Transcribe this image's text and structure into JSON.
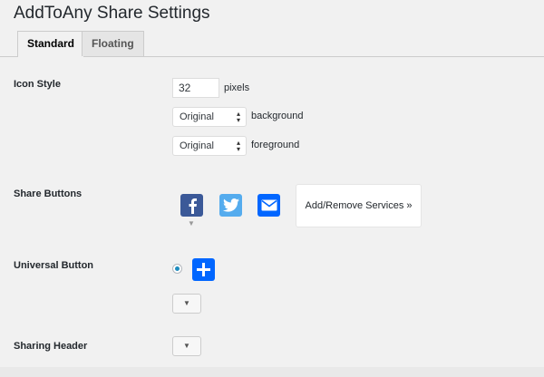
{
  "page": {
    "title": "AddToAny Share Settings"
  },
  "tabs": [
    {
      "label": "Standard",
      "active": true
    },
    {
      "label": "Floating",
      "active": false
    }
  ],
  "icon_style": {
    "label": "Icon Style",
    "size_value": "32",
    "size_unit": "pixels",
    "background_select": "Original",
    "background_label": "background",
    "foreground_select": "Original",
    "foreground_label": "foreground"
  },
  "share_buttons": {
    "label": "Share Buttons",
    "services": [
      {
        "name": "Facebook",
        "icon": "facebook-icon",
        "color": "#3b5998"
      },
      {
        "name": "Twitter",
        "icon": "twitter-icon",
        "color": "#55acee"
      },
      {
        "name": "Email",
        "icon": "email-icon",
        "color": "#0166ff"
      }
    ],
    "add_remove_label": "Add/Remove Services »"
  },
  "universal_button": {
    "label": "Universal Button",
    "icon": "plus-icon",
    "color": "#0166ff",
    "dropdown_glyph": "▼"
  },
  "sharing_header": {
    "label": "Sharing Header",
    "dropdown_glyph": "▼"
  }
}
